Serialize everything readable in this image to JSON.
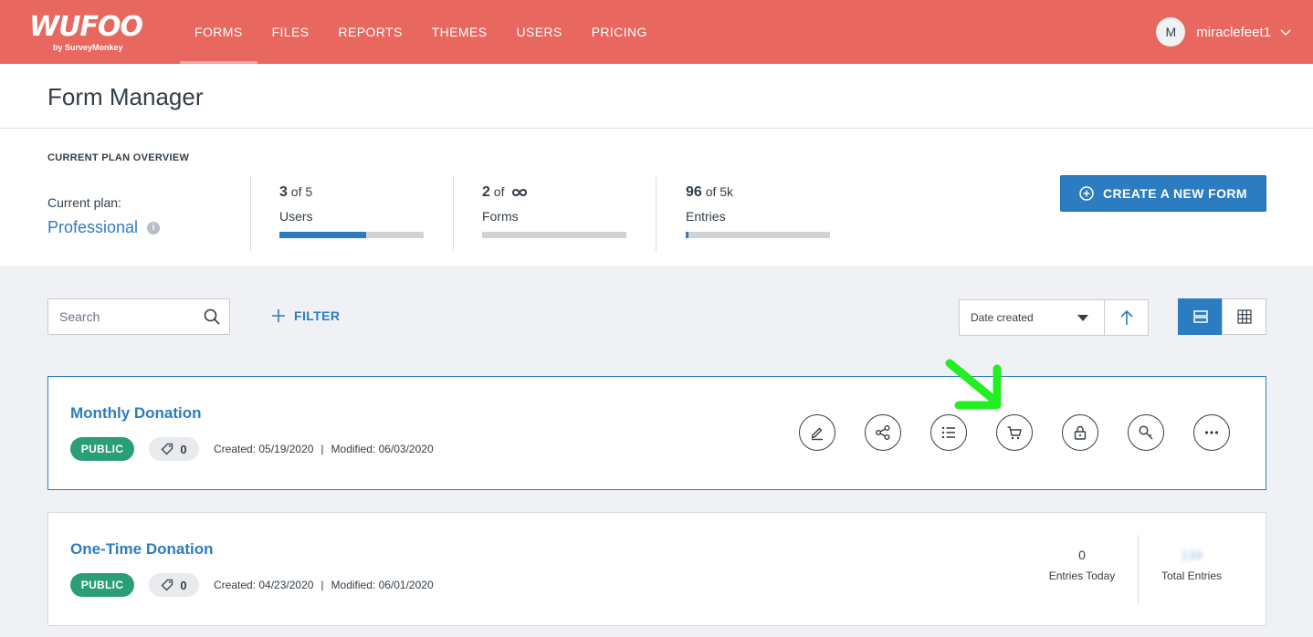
{
  "header": {
    "logo_text": "WUFOO",
    "logo_sub": "by SurveyMonkey",
    "nav": [
      {
        "label": "FORMS",
        "active": true
      },
      {
        "label": "FILES"
      },
      {
        "label": "REPORTS"
      },
      {
        "label": "THEMES"
      },
      {
        "label": "USERS"
      },
      {
        "label": "PRICING"
      }
    ],
    "avatar_initial": "M",
    "username": "miraclefeet1"
  },
  "page": {
    "title": "Form Manager"
  },
  "plan": {
    "heading": "CURRENT PLAN OVERVIEW",
    "current_plan_label": "Current plan:",
    "plan_name": "Professional",
    "stats": [
      {
        "used": "3",
        "limit": "of 5",
        "label": "Users",
        "usage_fraction": 0.6
      },
      {
        "used": "2",
        "limit": "of",
        "limit_icon": "infinity-icon",
        "label": "Forms",
        "usage_fraction": 0
      },
      {
        "used": "96",
        "limit": "of 5k",
        "label": "Entries",
        "usage_fraction": 0.02
      }
    ],
    "create_button": "CREATE A NEW FORM"
  },
  "toolbar": {
    "search_placeholder": "Search",
    "filter_label": "FILTER",
    "sort_value": "Date created",
    "view_mode": "list"
  },
  "forms": [
    {
      "title": "Monthly Donation",
      "status": "PUBLIC",
      "tag_count": "0",
      "created": "Created: 05/19/2020",
      "modified": "Modified: 06/03/2020",
      "actions": [
        "edit-icon",
        "share-icon",
        "entries-list-icon",
        "cart-icon",
        "lock-icon",
        "key-icon",
        "more-icon"
      ]
    },
    {
      "title": "One-Time Donation",
      "status": "PUBLIC",
      "tag_count": "0",
      "created": "Created: 04/23/2020",
      "modified": "Modified: 06/01/2020",
      "entries_today": "0",
      "entries_today_label": "Entries Today",
      "total_entries": "134",
      "total_entries_label": "Total Entries"
    }
  ],
  "colors": {
    "header_bg": "#e8675f",
    "accent_blue": "#2c7cc2",
    "public_green": "#2a9d79",
    "annotation_arrow": "#22ee22"
  }
}
